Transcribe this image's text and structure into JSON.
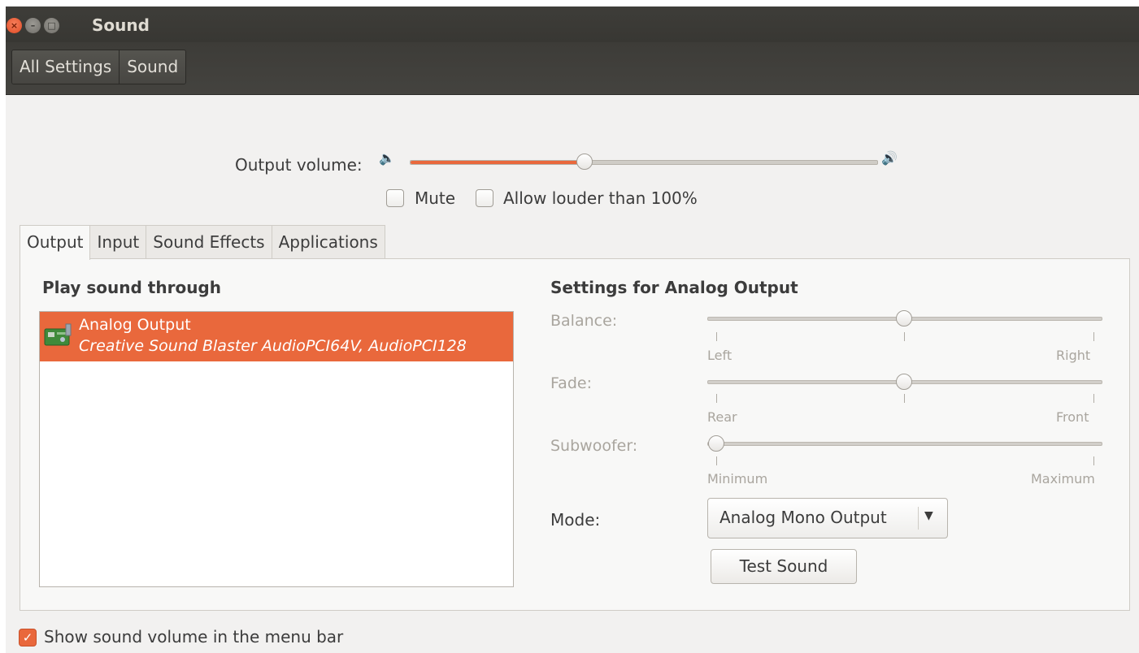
{
  "window": {
    "title": "Sound"
  },
  "titlebar_icons": {
    "close": "close-icon",
    "minimize": "minimize-icon",
    "maximize": "maximize-icon"
  },
  "breadcrumbs": [
    "All Settings",
    "Sound"
  ],
  "output_volume": {
    "label": "Output volume:",
    "level_fraction": 0.37,
    "low_icon": "speaker-low-icon",
    "high_icon": "speaker-high-icon"
  },
  "mute": {
    "label": "Mute",
    "checked": false
  },
  "allow_louder": {
    "label": "Allow louder than 100%",
    "checked": false
  },
  "tabs": [
    {
      "label": "Output",
      "active": true
    },
    {
      "label": "Input",
      "active": false
    },
    {
      "label": "Sound Effects",
      "active": false
    },
    {
      "label": "Applications",
      "active": false
    }
  ],
  "output_panel": {
    "device_heading": "Play sound through",
    "devices": [
      {
        "name": "Analog Output",
        "description": "Creative Sound Blaster AudioPCI64V, AudioPCI128",
        "selected": true,
        "icon": "sound-card-icon"
      }
    ],
    "settings_heading": "Settings for Analog Output",
    "balance": {
      "label": "Balance:",
      "value_fraction": 0.5,
      "min_label": "Left",
      "max_label": "Right"
    },
    "fade": {
      "label": "Fade:",
      "value_fraction": 0.5,
      "min_label": "Rear",
      "max_label": "Front"
    },
    "subwoofer": {
      "label": "Subwoofer:",
      "value_fraction": 0.0,
      "min_label": "Minimum",
      "max_label": "Maximum"
    },
    "mode": {
      "label": "Mode:",
      "value": "Analog Mono Output"
    },
    "test_button": "Test Sound"
  },
  "show_in_menubar": {
    "label": "Show sound volume in the menu bar",
    "checked": true
  },
  "colors": {
    "accent": "#e9683c",
    "titlebar": "#3c3b37",
    "window_bg": "#f2f1f0"
  }
}
